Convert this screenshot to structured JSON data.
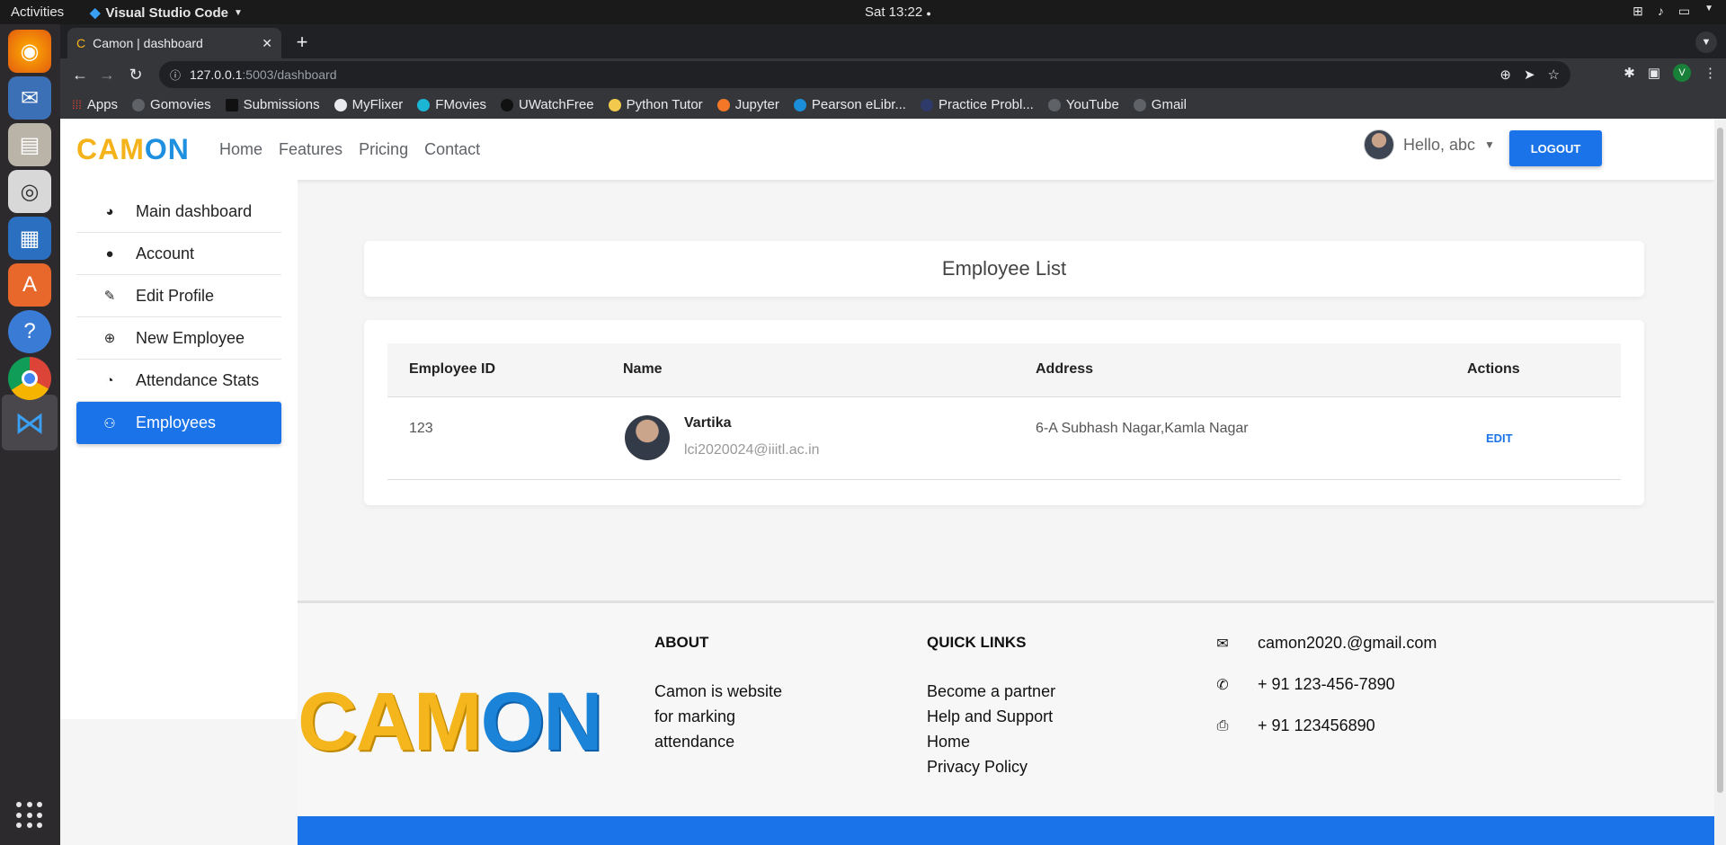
{
  "os": {
    "activities": "Activities",
    "app_name": "Visual Studio Code",
    "clock": "Sat 13:22"
  },
  "browser": {
    "tab_title": "Camon | dashboard",
    "url_host": "127.0.0.1",
    "url_path": ":5003/dashboard",
    "profile_initial": "V",
    "bookmarks": [
      "Apps",
      "Gomovies",
      "Submissions",
      "MyFlixer",
      "FMovies",
      "UWatchFree",
      "Python Tutor",
      "Jupyter",
      "Pearson eLibr...",
      "Practice Probl...",
      "YouTube",
      "Gmail"
    ]
  },
  "site": {
    "logo_part1": "CAM",
    "logo_part2": "ON",
    "nav": [
      "Home",
      "Features",
      "Pricing",
      "Contact"
    ],
    "greeting": "Hello, abc",
    "logout": "LOGOUT"
  },
  "sidebar": {
    "items": [
      {
        "label": "Main dashboard",
        "icon": "dashboard-icon"
      },
      {
        "label": "Account",
        "icon": "user-icon"
      },
      {
        "label": "Edit Profile",
        "icon": "user-edit-icon"
      },
      {
        "label": "New Employee",
        "icon": "plus-circle-icon"
      },
      {
        "label": "Attendance Stats",
        "icon": "pie-chart-icon"
      },
      {
        "label": "Employees",
        "icon": "users-icon"
      }
    ]
  },
  "employee_list": {
    "title": "Employee List",
    "columns": [
      "Employee ID",
      "Name",
      "Address",
      "Actions"
    ],
    "rows": [
      {
        "id": "123",
        "name": "Vartika",
        "email": "lci2020024@iiitl.ac.in",
        "address": "6-A Subhash Nagar,Kamla Nagar",
        "action": "EDIT"
      }
    ]
  },
  "footer": {
    "about_title": "ABOUT",
    "about_lines": [
      "Camon is website",
      "for marking",
      "attendance"
    ],
    "links_title": "QUICK LINKS",
    "links": [
      "Become a partner",
      "Help and Support",
      "Home",
      "Privacy Policy"
    ],
    "email": "camon2020.@gmail.com",
    "phone": "+ 91 123-456-7890",
    "fax": "+ 91 123456890"
  },
  "colors": {
    "primary": "#1a73e8",
    "logo_yellow": "#f5b31b",
    "logo_blue": "#1f8fe0"
  }
}
